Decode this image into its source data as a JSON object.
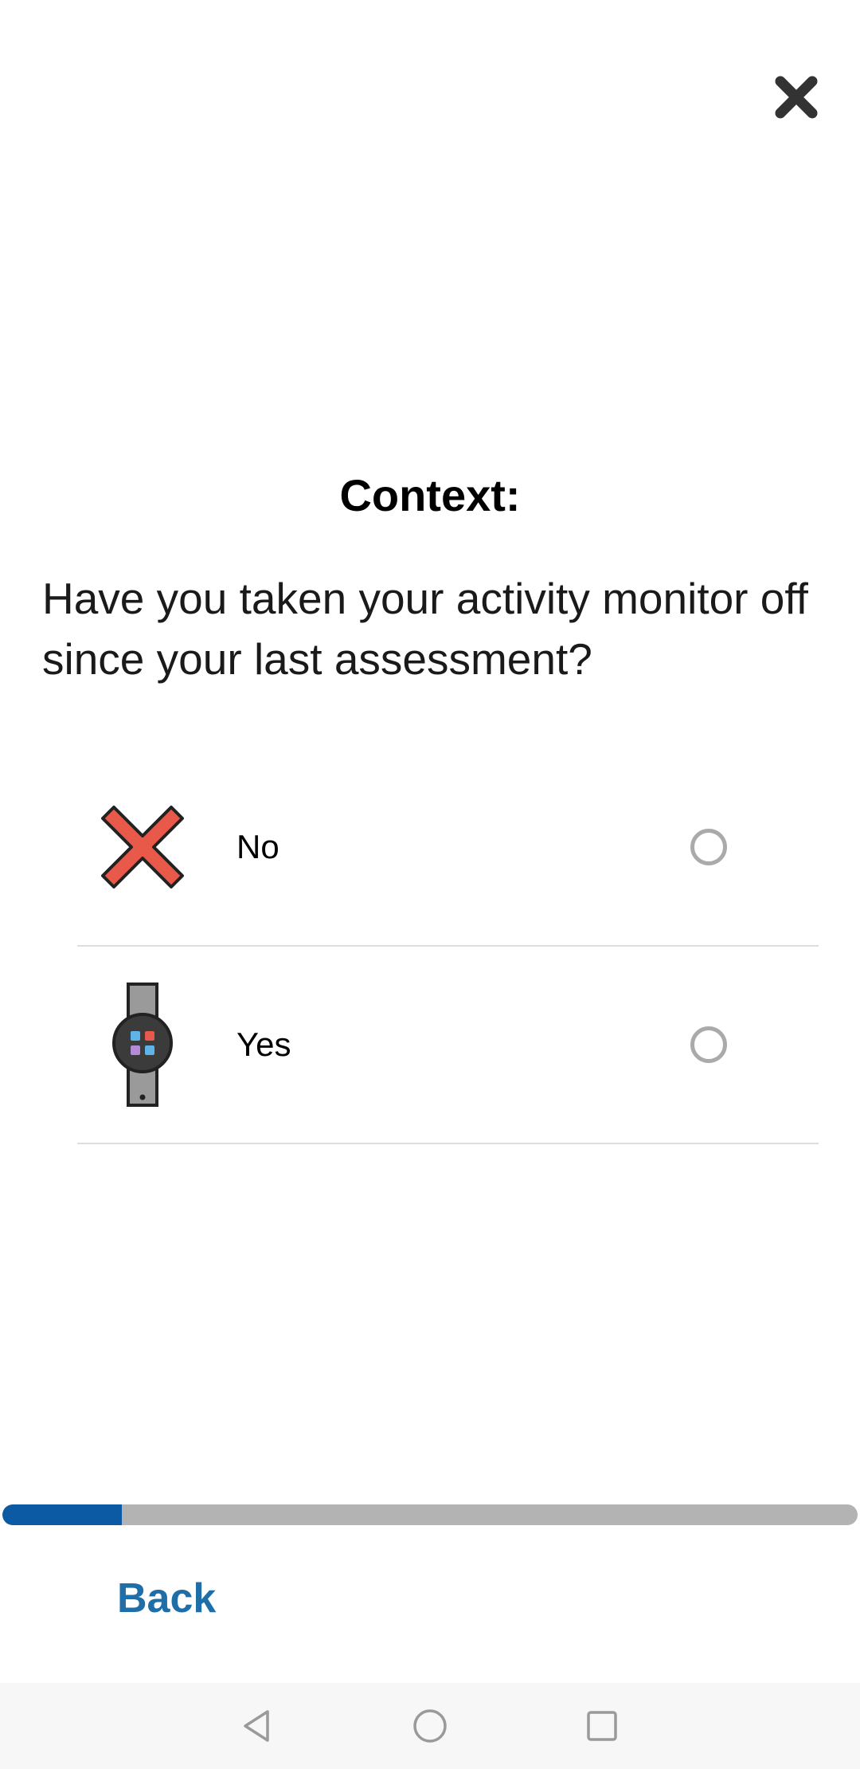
{
  "header": {
    "close_icon": "close-icon"
  },
  "survey": {
    "title": "Context:",
    "question": "Have you taken your activity monitor off since your last assessment?",
    "options": [
      {
        "label": "No",
        "icon": "red-x-icon",
        "selected": false
      },
      {
        "label": "Yes",
        "icon": "smartwatch-icon",
        "selected": false
      }
    ]
  },
  "progress": {
    "fraction": 0.14,
    "fill_color": "#0b5aa3",
    "track_color": "#b3b3b3"
  },
  "footer": {
    "back_label": "Back",
    "back_color": "#1f6ea8"
  },
  "nav_bar": {
    "back_icon": "nav-back-icon",
    "home_icon": "nav-home-icon",
    "recents_icon": "nav-recents-icon"
  }
}
